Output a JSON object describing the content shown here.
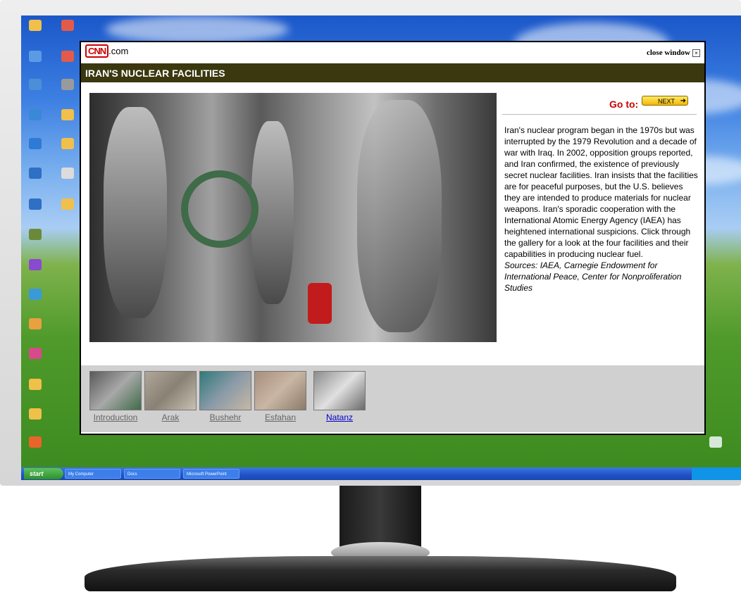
{
  "popup": {
    "logo_brand": "CNN",
    "logo_suffix": ".com",
    "close_label": "close window",
    "close_icon": "×",
    "title": "IRAN'S NUCLEAR FACILITIES",
    "goto_label": "Go to:",
    "next_label": "NEXT",
    "next_arrow": "➜",
    "description": "Iran's nuclear program began in the 1970s but was interrupted by the 1979 Revolution and a decade of war with Iraq. In 2002, opposition groups reported, and Iran confirmed, the existence of previously secret nuclear facilities. Iran insists that the facilities are for peaceful purposes, but the U.S. believes they are intended to produce materials for nuclear weapons. Iran's sporadic cooperation with the International Atomic Energy Agency (IAEA) has heightened international suspicions. Click through the gallery for a look at the four facilities and their capabilities in producing nuclear fuel.",
    "sources": "Sources: IAEA, Carnegie Endowment for International Peace, Center for Nonproliferation Studies",
    "gallery": [
      {
        "label": "Introduction"
      },
      {
        "label": "Arak"
      },
      {
        "label": "Bushehr"
      },
      {
        "label": "Esfahan"
      },
      {
        "label": "Natanz"
      }
    ]
  },
  "taskbar": {
    "start_label": "start",
    "buttons": [
      "My Computer",
      "Docs",
      "Microsoft PowerPoint"
    ]
  },
  "colors": {
    "cnn_red": "#cc0000",
    "titlebar": "#3b3810",
    "link_active": "#0000cc",
    "link_inactive": "#666666"
  }
}
